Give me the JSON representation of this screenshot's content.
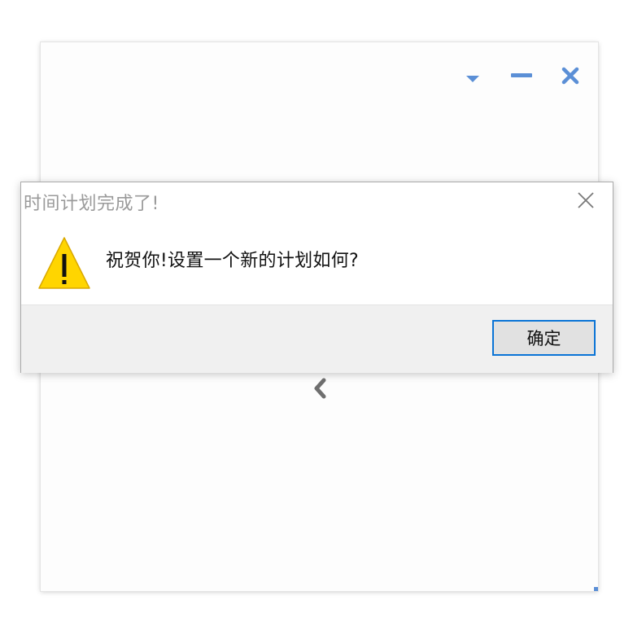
{
  "colors": {
    "accent": "#5b8fd6",
    "warning_fill": "#ffd500",
    "button_border": "#0a74d6"
  },
  "app_window": {
    "controls": [
      {
        "icon": "caret-down-icon",
        "role": "dropdown"
      },
      {
        "icon": "minimize-icon",
        "role": "minimize"
      },
      {
        "icon": "close-icon",
        "role": "close"
      }
    ],
    "back_icon": "chevron-left-icon"
  },
  "dialog": {
    "title": "时间计划完成了!",
    "icon": "warning-icon",
    "message": "祝贺你!设置一个新的计划如何?",
    "ok_label": "确定",
    "close_icon": "close-icon"
  }
}
